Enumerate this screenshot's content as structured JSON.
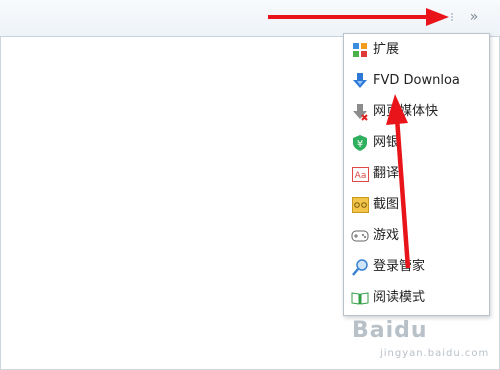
{
  "toolbar": {
    "overflow_label": "»"
  },
  "menu": {
    "items": [
      {
        "label": "扩展",
        "icon": "extensions-icon"
      },
      {
        "label": "FVD Downloa",
        "icon": "fvd-download-icon"
      },
      {
        "label": "网页媒体快",
        "icon": "media-sniffer-icon"
      },
      {
        "label": "网银",
        "icon": "online-banking-icon"
      },
      {
        "label": "翻译",
        "icon": "translate-icon"
      },
      {
        "label": "截图",
        "icon": "screenshot-icon"
      },
      {
        "label": "游戏",
        "icon": "gamepad-icon"
      },
      {
        "label": "登录管家",
        "icon": "login-manager-icon"
      },
      {
        "label": "阅读模式",
        "icon": "reading-mode-icon"
      }
    ]
  },
  "watermark": {
    "brand": "Baidu",
    "sub": "jingyan.baidu.com"
  },
  "colors": {
    "arrow": "#e8141a",
    "menu_border": "#b9c3cc",
    "toolbar_bg": "#eef3f8"
  }
}
